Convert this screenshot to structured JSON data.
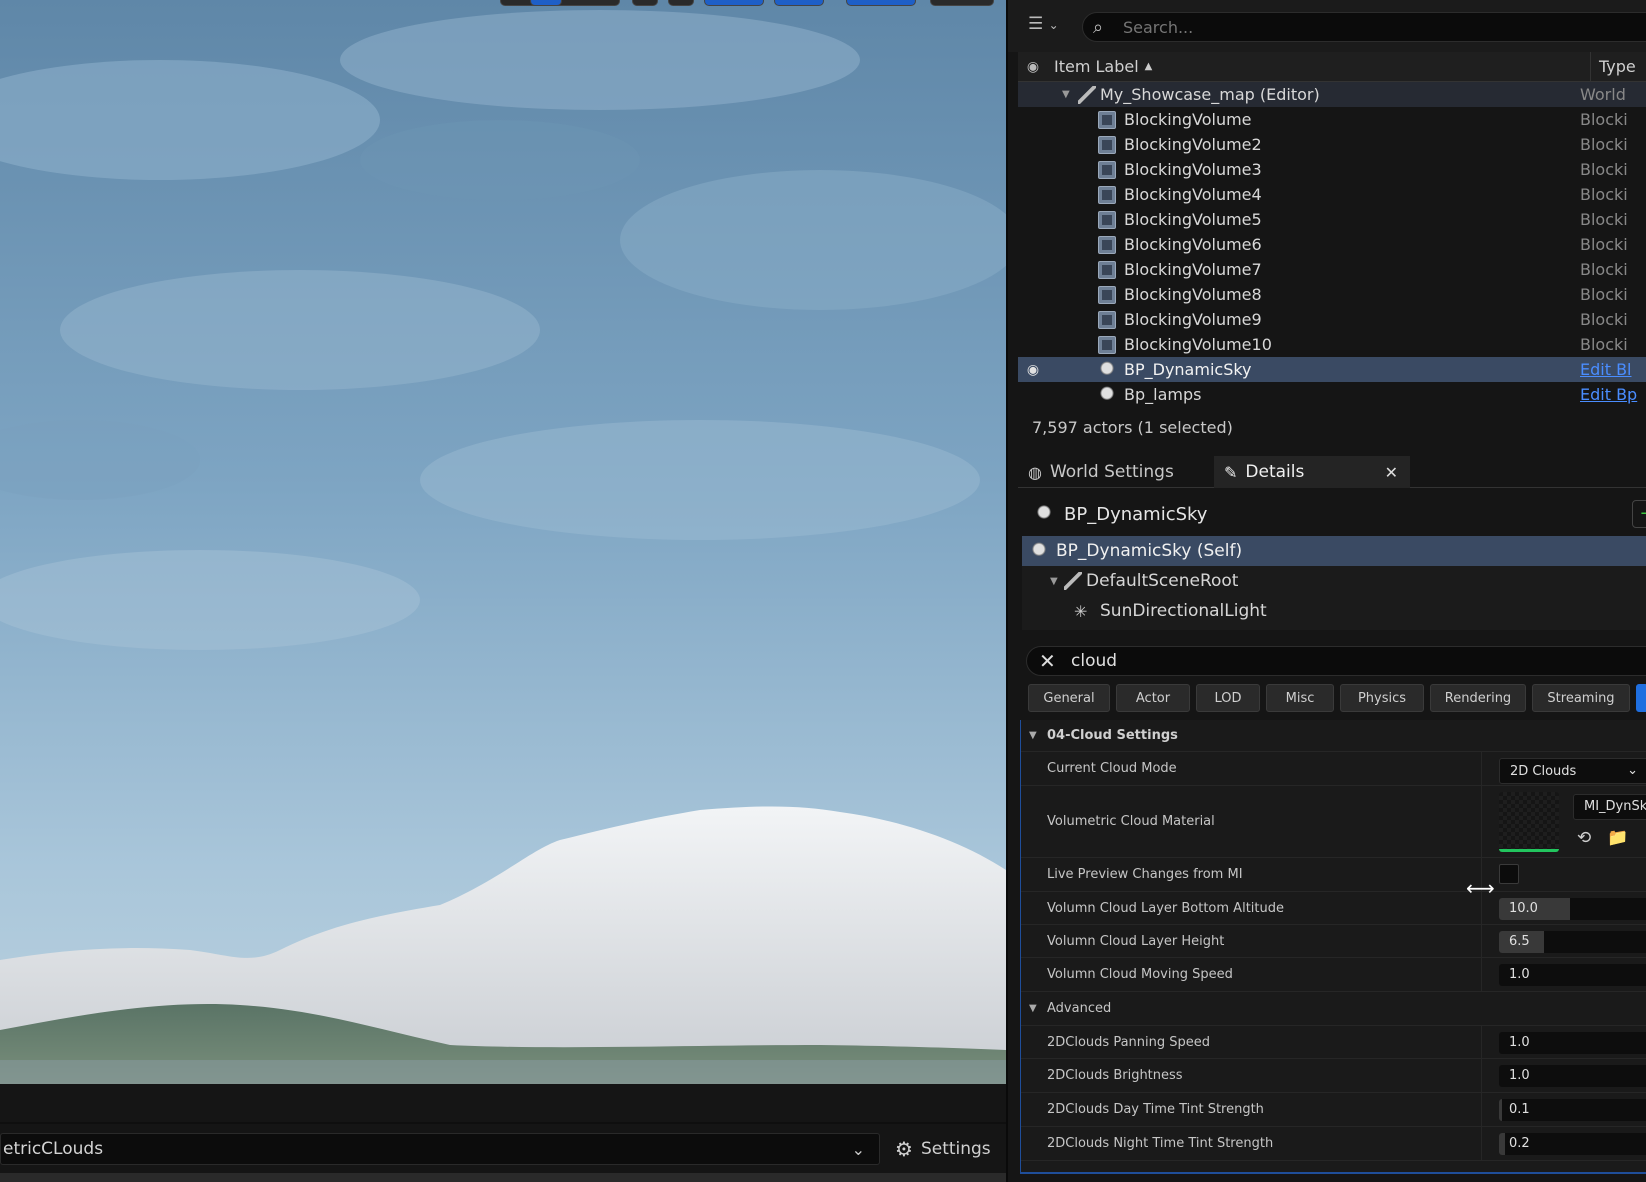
{
  "viewport": {
    "preset_value": "etricCLouds",
    "settings_label": "Settings"
  },
  "outliner": {
    "search_placeholder": "Search...",
    "col_label": "Item Label",
    "col_type": "Type",
    "rows": [
      {
        "name": "My_Showcase_map (Editor)",
        "type": "World",
        "kind": "world"
      },
      {
        "name": "BlockingVolume",
        "type": "Blocki",
        "kind": "cube"
      },
      {
        "name": "BlockingVolume2",
        "type": "Blocki",
        "kind": "cube"
      },
      {
        "name": "BlockingVolume3",
        "type": "Blocki",
        "kind": "cube"
      },
      {
        "name": "BlockingVolume4",
        "type": "Blocki",
        "kind": "cube"
      },
      {
        "name": "BlockingVolume5",
        "type": "Blocki",
        "kind": "cube"
      },
      {
        "name": "BlockingVolume6",
        "type": "Blocki",
        "kind": "cube"
      },
      {
        "name": "BlockingVolume7",
        "type": "Blocki",
        "kind": "cube"
      },
      {
        "name": "BlockingVolume8",
        "type": "Blocki",
        "kind": "cube"
      },
      {
        "name": "BlockingVolume9",
        "type": "Blocki",
        "kind": "cube"
      },
      {
        "name": "BlockingVolume10",
        "type": "Blocki",
        "kind": "cube"
      },
      {
        "name": "BP_DynamicSky",
        "type": "Edit Bl",
        "kind": "bp"
      },
      {
        "name": "Bp_lamps",
        "type": "Edit Bp",
        "kind": "bp"
      }
    ],
    "actor_count": "7,597 actors (1 selected)"
  },
  "tabs": {
    "world_settings": "World Settings",
    "details": "Details"
  },
  "details": {
    "title": "BP_DynamicSky",
    "add_label": "+",
    "components": {
      "self": "BP_DynamicSky (Self)",
      "root": "DefaultSceneRoot",
      "light": "SunDirectionalLight"
    },
    "search_value": "cloud",
    "categories": [
      "General",
      "Actor",
      "LOD",
      "Misc",
      "Physics",
      "Rendering",
      "Streaming"
    ],
    "section": "04-Cloud Settings",
    "props": {
      "cloud_mode_label": "Current Cloud Mode",
      "cloud_mode_value": "2D Clouds",
      "material_label": "Volumetric Cloud Material",
      "material_value": "MI_DynSkyV",
      "live_preview_label": "Live Preview Changes from MI",
      "bottom_alt_label": "Volumn Cloud Layer Bottom Altitude",
      "bottom_alt_value": "10.0",
      "height_label": "Volumn Cloud Layer Height",
      "height_value": "6.5",
      "moving_label": "Volumn Cloud Moving Speed",
      "moving_value": "1.0",
      "advanced_label": "Advanced",
      "panning_label": "2DClouds Panning Speed",
      "panning_value": "1.0",
      "brightness_label": "2DClouds Brightness",
      "brightness_value": "1.0",
      "day_tint_label": "2DClouds Day Time Tint Strength",
      "day_tint_value": "0.1",
      "night_tint_label": "2DClouds Night Time Tint Strength",
      "night_tint_value": "0.2"
    },
    "fills": {
      "bottom_alt": 0.47,
      "height": 0.3,
      "moving": 0,
      "panning": 0,
      "brightness": 0,
      "day_tint": 0.02,
      "night_tint": 0.04
    }
  }
}
